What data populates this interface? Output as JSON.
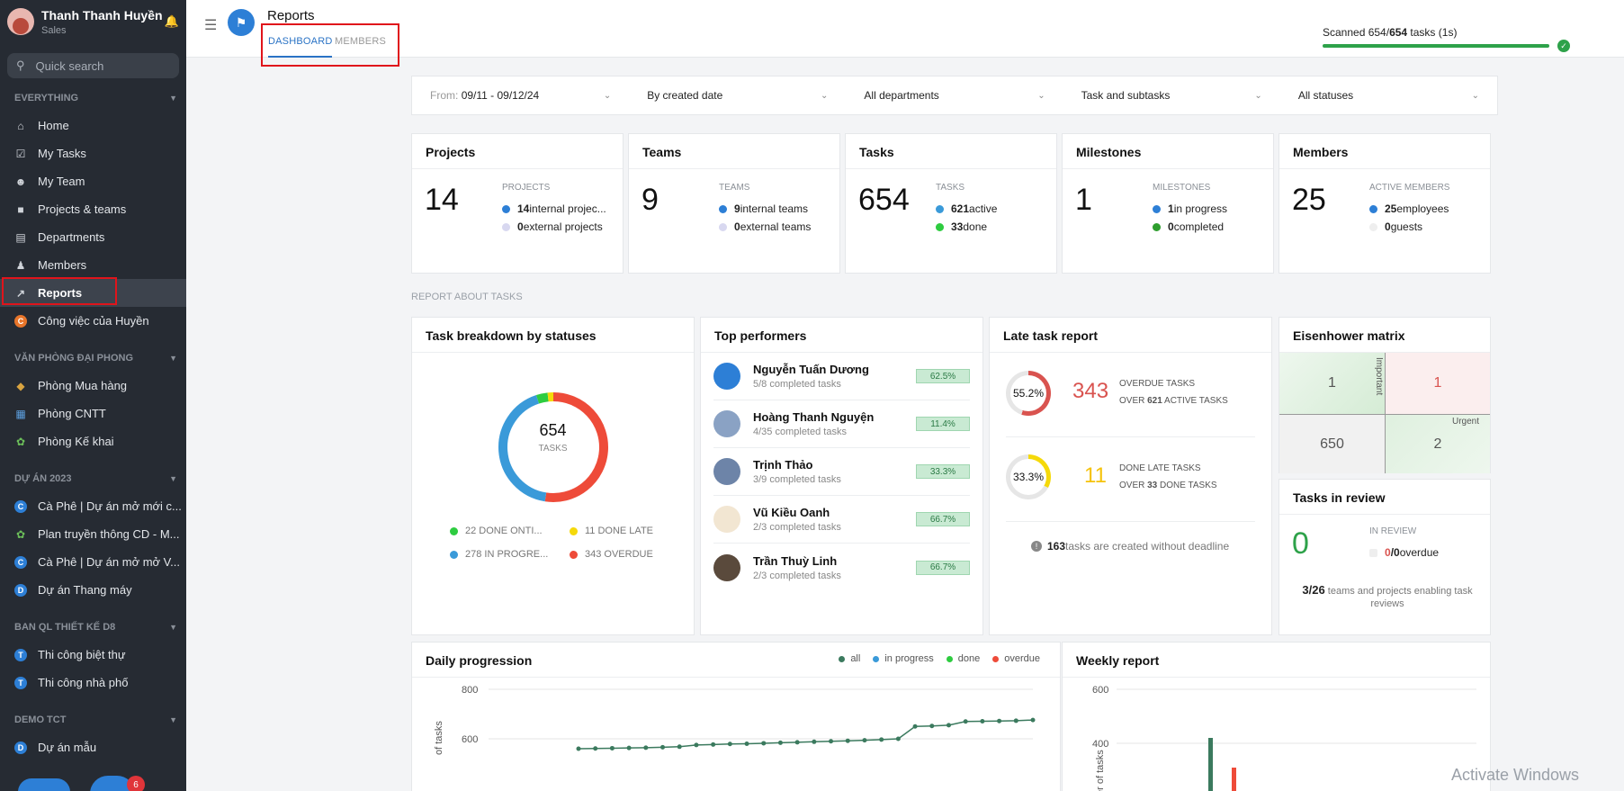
{
  "user": {
    "name": "Thanh Thanh Huyền",
    "role": "Sales"
  },
  "search": {
    "placeholder": "Quick search"
  },
  "sidebar": {
    "everything_label": "EVERYTHING",
    "items": [
      {
        "label": "Home",
        "icon": "home-icon"
      },
      {
        "label": "My Tasks",
        "icon": "checkbox-icon"
      },
      {
        "label": "My Team",
        "icon": "team-icon"
      },
      {
        "label": "Projects & teams",
        "icon": "folder-icon"
      },
      {
        "label": "Departments",
        "icon": "department-icon"
      },
      {
        "label": "Members",
        "icon": "members-icon"
      },
      {
        "label": "Reports",
        "icon": "chart-icon"
      },
      {
        "label": "Công việc của Huyền",
        "icon": "c-badge-icon"
      }
    ],
    "section2": "VĂN PHÒNG ĐẠI PHONG",
    "section2_items": [
      "Phòng Mua hàng",
      "Phòng CNTT",
      "Phòng Kế khai"
    ],
    "section3": "DỰ ÁN 2023",
    "section3_items": [
      "Cà Phê | Dự án mở mới c...",
      "Plan truyền thông CD - M...",
      "Cà Phê | Dự án mở mở V...",
      "Dự án Thang máy"
    ],
    "section4": "BAN QL THIẾT KẾ D8",
    "section4_items": [
      "Thi công biệt thự",
      "Thi công nhà phố"
    ],
    "section5": "DEMO TCT",
    "section5_items": [
      "Dự án mẫu"
    ],
    "notif_count": "6"
  },
  "header": {
    "title": "Reports",
    "tab_dashboard": "DASHBOARD",
    "tab_members": "MEMBERS",
    "scan_prefix": "Scanned 654/",
    "scan_bold": "654",
    "scan_suffix": " tasks (1s)"
  },
  "filters": {
    "from_label": "From:",
    "from_value": "09/11 - 09/12/24",
    "date_type": "By created date",
    "departments": "All departments",
    "task_type": "Task and subtasks",
    "statuses": "All statuses"
  },
  "stats": {
    "projects": {
      "title": "Projects",
      "value": "14",
      "label": "PROJECTS",
      "r1n": "14",
      "r1t": " internal projec...",
      "r2n": "0",
      "r2t": " external projects"
    },
    "teams": {
      "title": "Teams",
      "value": "9",
      "label": "TEAMS",
      "r1n": "9",
      "r1t": " internal teams",
      "r2n": "0",
      "r2t": " external teams"
    },
    "tasks": {
      "title": "Tasks",
      "value": "654",
      "label": "TASKS",
      "r1n": "621",
      "r1t": " active",
      "r2n": "33",
      "r2t": " done"
    },
    "milestones": {
      "title": "Milestones",
      "value": "1",
      "label": "MILESTONES",
      "r1n": "1",
      "r1t": " in progress",
      "r2n": "0",
      "r2t": " completed"
    },
    "members": {
      "title": "Members",
      "value": "25",
      "label": "ACTIVE MEMBERS",
      "r1n": "25",
      "r1t": " employees",
      "r2n": "0",
      "r2t": " guests"
    }
  },
  "report_label": "REPORT ABOUT TASKS",
  "breakdown": {
    "title": "Task breakdown by statuses",
    "total": "654",
    "total_label": "TASKS",
    "legend": [
      "22 DONE ONTI...",
      "11 DONE LATE",
      "278 IN PROGRE...",
      "343 OVERDUE"
    ],
    "colors": {
      "done_ontime": "#2ecc40",
      "done_late": "#f5d90a",
      "in_progress": "#3a9ad9",
      "overdue": "#ee4b39"
    }
  },
  "performers": {
    "title": "Top performers",
    "list": [
      {
        "name": "Nguyễn Tuấn Dương",
        "done": "5",
        "rest": "/8 completed tasks",
        "pct": "62.5%"
      },
      {
        "name": "Hoàng Thanh Nguyện",
        "done": "4",
        "rest": "/35 completed tasks",
        "pct": "11.4%"
      },
      {
        "name": "Trịnh Thảo",
        "done": "3",
        "rest": "/9 completed tasks",
        "pct": "33.3%"
      },
      {
        "name": "Vũ Kiều Oanh",
        "done": "2",
        "rest": "/3 completed tasks",
        "pct": "66.7%"
      },
      {
        "name": "Trần Thuỳ Linh",
        "done": "2",
        "rest": "/3 completed tasks",
        "pct": "66.7%"
      }
    ]
  },
  "late": {
    "title": "Late task report",
    "ring1": "55.2%",
    "value1": "343",
    "l1a": "OVERDUE TASKS",
    "l1b_pre": "OVER ",
    "l1b_num": "621",
    "l1b_post": " ACTIVE TASKS",
    "ring2": "33.3%",
    "value2": "11",
    "l2a": "DONE LATE TASKS",
    "l2b_pre": "OVER ",
    "l2b_num": "33",
    "l2b_post": " DONE TASKS",
    "note_num": "163",
    "note_text": " tasks are created without deadline"
  },
  "eisenhower": {
    "title": "Eisenhower matrix",
    "q1": "1",
    "q2": "1",
    "q3": "650",
    "q4": "2",
    "important": "Important",
    "urgent": "Urgent"
  },
  "review": {
    "title": "Tasks in review",
    "value": "0",
    "label": "IN REVIEW",
    "overdue_a": "0",
    "overdue_b": "/0",
    "overdue_text": " overdue",
    "teams_num": "3/26",
    "teams_text": " teams and projects enabling task reviews"
  },
  "daily": {
    "title": "Daily progression",
    "legend": [
      "all",
      "in progress",
      "done",
      "overdue"
    ],
    "ylabel": "of tasks"
  },
  "weekly": {
    "title": "Weekly report",
    "ylabel": "er of tasks"
  },
  "watermark": "Activate Windows",
  "chart_data": [
    {
      "type": "pie",
      "title": "Task breakdown by statuses",
      "categories": [
        "DONE ONTIME",
        "DONE LATE",
        "IN PROGRESS",
        "OVERDUE"
      ],
      "values": [
        22,
        11,
        278,
        343
      ]
    },
    {
      "type": "line",
      "title": "Daily progression",
      "ylim": [
        500,
        800
      ],
      "yticks": [
        600,
        800
      ],
      "series": [
        {
          "name": "all",
          "values": [
            560,
            561,
            562,
            563,
            564,
            566,
            568,
            575,
            577,
            579,
            580,
            582,
            584,
            586,
            588,
            590,
            592,
            594,
            597,
            600,
            650,
            652,
            655,
            670,
            671,
            672,
            673,
            676
          ]
        }
      ]
    },
    {
      "type": "bar",
      "title": "Weekly report",
      "ylim": [
        300,
        600
      ],
      "yticks": [
        400,
        600
      ],
      "series": [
        {
          "name": "all",
          "values": [
            420
          ]
        },
        {
          "name": "overdue",
          "values": [
            310
          ]
        }
      ]
    }
  ]
}
